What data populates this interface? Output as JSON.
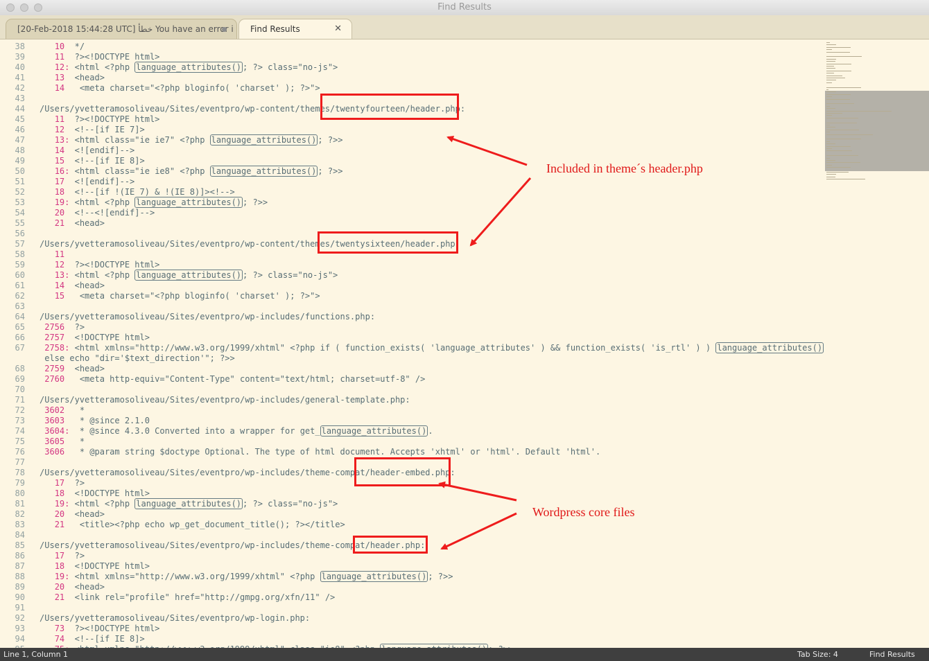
{
  "window": {
    "title": "Find Results"
  },
  "tabs": [
    {
      "label": "[20-Feb-2018 15:44:28 UTC] خطأ You have an error i",
      "active": false
    },
    {
      "label": "Find Results",
      "active": true
    }
  ],
  "lines": [
    {
      "n": "38",
      "segs": [
        {
          "t": "   "
        },
        {
          "t": "10",
          "c": "ln"
        },
        {
          "t": "  */"
        }
      ]
    },
    {
      "n": "39",
      "segs": [
        {
          "t": "   "
        },
        {
          "t": "11",
          "c": "ln"
        },
        {
          "t": "  ?><!DOCTYPE html>"
        }
      ]
    },
    {
      "n": "40",
      "segs": [
        {
          "t": "   "
        },
        {
          "t": "12:",
          "c": "ln"
        },
        {
          "t": " <html <?php "
        },
        {
          "t": "language_attributes()",
          "c": "hl"
        },
        {
          "t": "; ?> class=\"no-js\">"
        }
      ]
    },
    {
      "n": "41",
      "segs": [
        {
          "t": "   "
        },
        {
          "t": "13",
          "c": "ln"
        },
        {
          "t": "  <head>"
        }
      ]
    },
    {
      "n": "42",
      "segs": [
        {
          "t": "   "
        },
        {
          "t": "14",
          "c": "ln"
        },
        {
          "t": "   <meta charset=\"<?php bloginfo( 'charset' ); ?>\">"
        }
      ]
    },
    {
      "n": "43",
      "segs": []
    },
    {
      "n": "44",
      "segs": [
        {
          "t": "/Users/yvetteramosoliveau/Sites/eventpro/wp-content/themes/twentyfourteen/header.php:"
        }
      ]
    },
    {
      "n": "45",
      "segs": [
        {
          "t": "   "
        },
        {
          "t": "11",
          "c": "ln"
        },
        {
          "t": "  ?><!DOCTYPE html>"
        }
      ]
    },
    {
      "n": "46",
      "segs": [
        {
          "t": "   "
        },
        {
          "t": "12",
          "c": "ln"
        },
        {
          "t": "  <!--[if IE 7]>"
        }
      ]
    },
    {
      "n": "47",
      "segs": [
        {
          "t": "   "
        },
        {
          "t": "13:",
          "c": "ln"
        },
        {
          "t": " <html class=\"ie ie7\" <?php "
        },
        {
          "t": "language_attributes()",
          "c": "hl"
        },
        {
          "t": "; ?>>"
        }
      ]
    },
    {
      "n": "48",
      "segs": [
        {
          "t": "   "
        },
        {
          "t": "14",
          "c": "ln"
        },
        {
          "t": "  <![endif]-->"
        }
      ]
    },
    {
      "n": "49",
      "segs": [
        {
          "t": "   "
        },
        {
          "t": "15",
          "c": "ln"
        },
        {
          "t": "  <!--[if IE 8]>"
        }
      ]
    },
    {
      "n": "50",
      "segs": [
        {
          "t": "   "
        },
        {
          "t": "16:",
          "c": "ln"
        },
        {
          "t": " <html class=\"ie ie8\" <?php "
        },
        {
          "t": "language_attributes()",
          "c": "hl"
        },
        {
          "t": "; ?>>"
        }
      ]
    },
    {
      "n": "51",
      "segs": [
        {
          "t": "   "
        },
        {
          "t": "17",
          "c": "ln"
        },
        {
          "t": "  <![endif]-->"
        }
      ]
    },
    {
      "n": "52",
      "segs": [
        {
          "t": "   "
        },
        {
          "t": "18",
          "c": "ln"
        },
        {
          "t": "  <!--[if !(IE 7) & !(IE 8)]><!-->"
        }
      ]
    },
    {
      "n": "53",
      "segs": [
        {
          "t": "   "
        },
        {
          "t": "19:",
          "c": "ln"
        },
        {
          "t": " <html <?php "
        },
        {
          "t": "language_attributes()",
          "c": "hl"
        },
        {
          "t": "; ?>>"
        }
      ]
    },
    {
      "n": "54",
      "segs": [
        {
          "t": "   "
        },
        {
          "t": "20",
          "c": "ln"
        },
        {
          "t": "  <!--<![endif]-->"
        }
      ]
    },
    {
      "n": "55",
      "segs": [
        {
          "t": "   "
        },
        {
          "t": "21",
          "c": "ln"
        },
        {
          "t": "  <head>"
        }
      ]
    },
    {
      "n": "56",
      "segs": []
    },
    {
      "n": "57",
      "segs": [
        {
          "t": "/Users/yvetteramosoliveau/Sites/eventpro/wp-content/themes/twentysixteen/header.php:"
        }
      ]
    },
    {
      "n": "58",
      "segs": [
        {
          "t": "   "
        },
        {
          "t": "11",
          "c": "ln"
        }
      ]
    },
    {
      "n": "59",
      "segs": [
        {
          "t": "   "
        },
        {
          "t": "12",
          "c": "ln"
        },
        {
          "t": "  ?><!DOCTYPE html>"
        }
      ]
    },
    {
      "n": "60",
      "segs": [
        {
          "t": "   "
        },
        {
          "t": "13:",
          "c": "ln"
        },
        {
          "t": " <html <?php "
        },
        {
          "t": "language_attributes()",
          "c": "hl"
        },
        {
          "t": "; ?> class=\"no-js\">"
        }
      ]
    },
    {
      "n": "61",
      "segs": [
        {
          "t": "   "
        },
        {
          "t": "14",
          "c": "ln"
        },
        {
          "t": "  <head>"
        }
      ]
    },
    {
      "n": "62",
      "segs": [
        {
          "t": "   "
        },
        {
          "t": "15",
          "c": "ln"
        },
        {
          "t": "   <meta charset=\"<?php bloginfo( 'charset' ); ?>\">"
        }
      ]
    },
    {
      "n": "63",
      "segs": []
    },
    {
      "n": "64",
      "segs": [
        {
          "t": "/Users/yvetteramosoliveau/Sites/eventpro/wp-includes/functions.php:"
        }
      ]
    },
    {
      "n": "65",
      "segs": [
        {
          "t": " "
        },
        {
          "t": "2756",
          "c": "ln"
        },
        {
          "t": "  ?>"
        }
      ]
    },
    {
      "n": "66",
      "segs": [
        {
          "t": " "
        },
        {
          "t": "2757",
          "c": "ln"
        },
        {
          "t": "  <!DOCTYPE html>"
        }
      ]
    },
    {
      "n": "67",
      "segs": [
        {
          "t": " "
        },
        {
          "t": "2758:",
          "c": "ln"
        },
        {
          "t": " <html xmlns=\"http://www.w3.org/1999/xhtml\" <?php if ( function_exists( 'language_attributes' ) && function_exists( 'is_rtl' ) ) "
        },
        {
          "t": "language_attributes()",
          "c": "hl"
        },
        {
          "t": ";"
        }
      ]
    },
    {
      "n": "",
      "segs": [
        {
          "t": " else echo \"dir='$text_direction'\"; ?>>"
        }
      ]
    },
    {
      "n": "68",
      "segs": [
        {
          "t": " "
        },
        {
          "t": "2759",
          "c": "ln"
        },
        {
          "t": "  <head>"
        }
      ]
    },
    {
      "n": "69",
      "segs": [
        {
          "t": " "
        },
        {
          "t": "2760",
          "c": "ln"
        },
        {
          "t": "   <meta http-equiv=\"Content-Type\" content=\"text/html; charset=utf-8\" />"
        }
      ]
    },
    {
      "n": "70",
      "segs": []
    },
    {
      "n": "71",
      "segs": [
        {
          "t": "/Users/yvetteramosoliveau/Sites/eventpro/wp-includes/general-template.php:"
        }
      ]
    },
    {
      "n": "72",
      "segs": [
        {
          "t": " "
        },
        {
          "t": "3602",
          "c": "ln"
        },
        {
          "t": "   *"
        }
      ]
    },
    {
      "n": "73",
      "segs": [
        {
          "t": " "
        },
        {
          "t": "3603",
          "c": "ln"
        },
        {
          "t": "   * @since 2.1.0"
        }
      ]
    },
    {
      "n": "74",
      "segs": [
        {
          "t": " "
        },
        {
          "t": "3604:",
          "c": "ln"
        },
        {
          "t": "  * @since 4.3.0 Converted into a wrapper for get_"
        },
        {
          "t": "language_attributes()",
          "c": "hl"
        },
        {
          "t": "."
        }
      ]
    },
    {
      "n": "75",
      "segs": [
        {
          "t": " "
        },
        {
          "t": "3605",
          "c": "ln"
        },
        {
          "t": "   *"
        }
      ]
    },
    {
      "n": "76",
      "segs": [
        {
          "t": " "
        },
        {
          "t": "3606",
          "c": "ln"
        },
        {
          "t": "   * @param string $doctype Optional. The type of html document. Accepts 'xhtml' or 'html'. Default 'html'."
        }
      ]
    },
    {
      "n": "77",
      "segs": []
    },
    {
      "n": "78",
      "segs": [
        {
          "t": "/Users/yvetteramosoliveau/Sites/eventpro/wp-includes/theme-compat/header-embed.php:"
        }
      ]
    },
    {
      "n": "79",
      "segs": [
        {
          "t": "   "
        },
        {
          "t": "17",
          "c": "ln"
        },
        {
          "t": "  ?>"
        }
      ]
    },
    {
      "n": "80",
      "segs": [
        {
          "t": "   "
        },
        {
          "t": "18",
          "c": "ln"
        },
        {
          "t": "  <!DOCTYPE html>"
        }
      ]
    },
    {
      "n": "81",
      "segs": [
        {
          "t": "   "
        },
        {
          "t": "19:",
          "c": "ln"
        },
        {
          "t": " <html <?php "
        },
        {
          "t": "language_attributes()",
          "c": "hl"
        },
        {
          "t": "; ?> class=\"no-js\">"
        }
      ]
    },
    {
      "n": "82",
      "segs": [
        {
          "t": "   "
        },
        {
          "t": "20",
          "c": "ln"
        },
        {
          "t": "  <head>"
        }
      ]
    },
    {
      "n": "83",
      "segs": [
        {
          "t": "   "
        },
        {
          "t": "21",
          "c": "ln"
        },
        {
          "t": "   <title><?php echo wp_get_document_title(); ?></title>"
        }
      ]
    },
    {
      "n": "84",
      "segs": []
    },
    {
      "n": "85",
      "segs": [
        {
          "t": "/Users/yvetteramosoliveau/Sites/eventpro/wp-includes/theme-compat/header.php:"
        }
      ]
    },
    {
      "n": "86",
      "segs": [
        {
          "t": "   "
        },
        {
          "t": "17",
          "c": "ln"
        },
        {
          "t": "  ?>"
        }
      ]
    },
    {
      "n": "87",
      "segs": [
        {
          "t": "   "
        },
        {
          "t": "18",
          "c": "ln"
        },
        {
          "t": "  <!DOCTYPE html>"
        }
      ]
    },
    {
      "n": "88",
      "segs": [
        {
          "t": "   "
        },
        {
          "t": "19:",
          "c": "ln"
        },
        {
          "t": " <html xmlns=\"http://www.w3.org/1999/xhtml\" <?php "
        },
        {
          "t": "language_attributes()",
          "c": "hl"
        },
        {
          "t": "; ?>>"
        }
      ]
    },
    {
      "n": "89",
      "segs": [
        {
          "t": "   "
        },
        {
          "t": "20",
          "c": "ln"
        },
        {
          "t": "  <head>"
        }
      ]
    },
    {
      "n": "90",
      "segs": [
        {
          "t": "   "
        },
        {
          "t": "21",
          "c": "ln"
        },
        {
          "t": "  <link rel=\"profile\" href=\"http://gmpg.org/xfn/11\" />"
        }
      ]
    },
    {
      "n": "91",
      "segs": []
    },
    {
      "n": "92",
      "segs": [
        {
          "t": "/Users/yvetteramosoliveau/Sites/eventpro/wp-login.php:"
        }
      ]
    },
    {
      "n": "93",
      "segs": [
        {
          "t": "   "
        },
        {
          "t": "73",
          "c": "ln"
        },
        {
          "t": "  ?><!DOCTYPE html>"
        }
      ]
    },
    {
      "n": "94",
      "segs": [
        {
          "t": "   "
        },
        {
          "t": "74",
          "c": "ln"
        },
        {
          "t": "  <!--[if IE 8]>"
        }
      ]
    },
    {
      "n": "95",
      "segs": [
        {
          "t": "   "
        },
        {
          "t": "75:",
          "c": "ln"
        },
        {
          "t": " <html xmlns=\"http://www.w3.org/1999/xhtml\" class=\"ie8\" <?php "
        },
        {
          "t": "language_attributes()",
          "c": "hl"
        },
        {
          "t": "; ?>>"
        }
      ]
    }
  ],
  "annotations": {
    "theme_label": "Included in theme´s header.php",
    "core_label": "Wordpress core files",
    "color": "#ee1c1c"
  },
  "status": {
    "position": "Line 1, Column 1",
    "tab_size": "Tab Size: 4",
    "syntax": "Find Results"
  },
  "colors": {
    "background": "#fdf6e3",
    "line_number_accent": "#d33682",
    "status_bar": "#3f3f3f"
  }
}
